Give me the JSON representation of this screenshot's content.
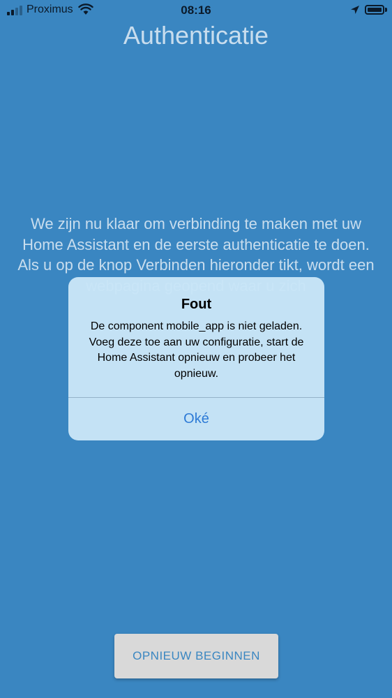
{
  "status_bar": {
    "carrier": "Proximus",
    "time": "08:16",
    "icons": [
      "signal-icon",
      "wifi-icon",
      "location-arrow-icon",
      "battery-icon"
    ]
  },
  "screen": {
    "title": "Authenticatie",
    "body_text": "We zijn nu klaar om verbinding te maken met uw Home Assistant en de eerste authenticatie te doen. Als u op de knop Verbinden hieronder tikt, wordt een webpagina geopend waar u zich"
  },
  "alert": {
    "title": "Fout",
    "message": "De component mobile_app is niet geladen. Voeg deze toe aan uw configuratie, start de Home Assistant opnieuw en probeer het opnieuw.",
    "ok_label": "Oké"
  },
  "footer": {
    "restart_label": "OPNIEUW BEGINNEN"
  },
  "colors": {
    "background": "#3a86c1",
    "alert_background": "#c8e5f7",
    "accent": "#2d7ad6",
    "button_background": "#d9d9d9"
  }
}
